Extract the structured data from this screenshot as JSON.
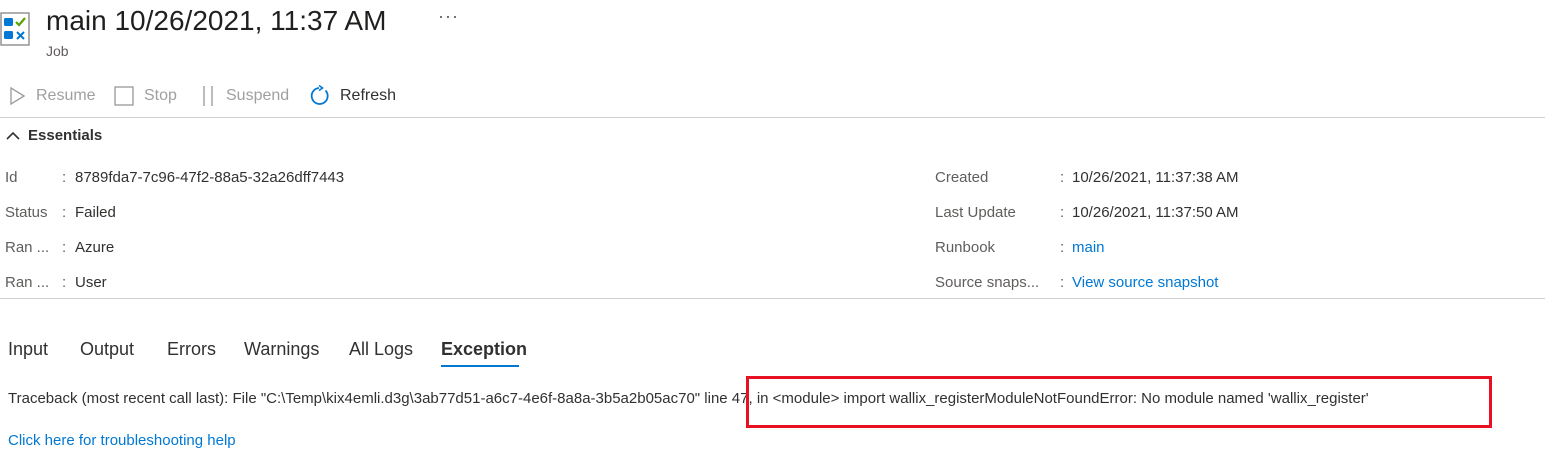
{
  "header": {
    "title": "main 10/26/2021, 11:37 AM",
    "subtitle": "Job",
    "more_label": "···",
    "icon": "runbook-job-icon"
  },
  "toolbar": {
    "resume": "Resume",
    "stop": "Stop",
    "suspend": "Suspend",
    "refresh": "Refresh"
  },
  "essentials": {
    "title": "Essentials",
    "left": [
      {
        "key": "Id",
        "value": "8789fda7-7c96-47f2-88a5-32a26dff7443"
      },
      {
        "key": "Status",
        "value": "Failed"
      },
      {
        "key": "Ran ...",
        "value": "Azure"
      },
      {
        "key": "Ran ...",
        "value": "User"
      }
    ],
    "right": [
      {
        "key": "Created",
        "value": "10/26/2021, 11:37:38 AM"
      },
      {
        "key": "Last Update",
        "value": "10/26/2021, 11:37:50 AM"
      },
      {
        "key": "Runbook",
        "value": "main"
      },
      {
        "key": "Source snaps...",
        "value": "View source snapshot"
      }
    ],
    "separator": ":"
  },
  "tabs": [
    "Input",
    "Output",
    "Errors",
    "Warnings",
    "All Logs",
    "Exception"
  ],
  "active_tab": "Exception",
  "exception": {
    "text_part1": "Traceback (most recent call last): File \"C:\\Temp\\kix4emli.d3g\\3ab77d51-a6c7-4e6f-8a8a-3b5a2b05ac70\"",
    "text_part2": " line 47, in <module> import wallix_registerModuleNotFoundError: No module named 'wallix_register'",
    "help_link": "Click here for troubleshooting help"
  },
  "colors": {
    "accent": "#0078d4",
    "highlight_border": "#e81123"
  }
}
